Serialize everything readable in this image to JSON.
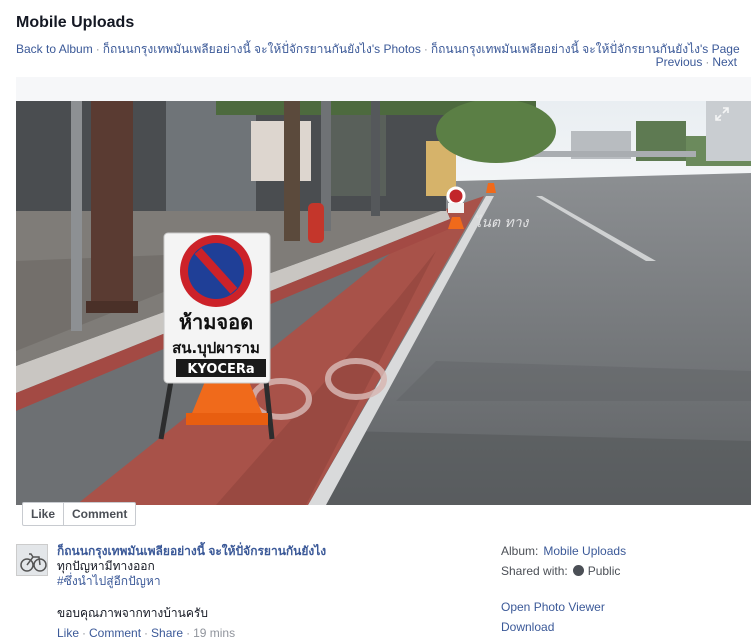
{
  "page": {
    "title": "Mobile Uploads"
  },
  "breadcrumbs": {
    "back": "Back to Album",
    "sep1": "·",
    "photos": "ก็ถนนกรุงเทพมันเพลียอย่างนี้ จะให้ปั่จักรยานกันยังไง's Photos",
    "sep2": "·",
    "page": "ก็ถนนกรุงเทพมันเพลียอย่างนี้ จะให้ปั่จักรยานกันยังไง's Page"
  },
  "pager": {
    "previous": "Previous",
    "sep": "·",
    "next": "Next"
  },
  "photo": {
    "sign_line1": "ห้ามจอด",
    "sign_line2": "สน.บุปผาราม",
    "sign_brand": "KYOCERa",
    "road_text": "ไนต ทาง"
  },
  "photo_actions": {
    "like": "Like",
    "comment": "Comment"
  },
  "post": {
    "author": "ก็ถนนกรุงเทพมันเพลียอย่างนี้ จะให้ปั่จักรยานกันยังไง",
    "line1": "ทุกปัญหามีทางออก",
    "hashtag": "#ซึ่งนำไปสู่อีกปัญหา",
    "message": "ขอบคุณภาพจากทางบ้านครับ",
    "actions": {
      "like": "Like",
      "comment": "Comment",
      "share": "Share",
      "time": "19 mins",
      "sep": "·"
    }
  },
  "sidebar": {
    "album_label": "Album:",
    "album_value": "Mobile Uploads",
    "shared_label": "Shared with:",
    "shared_value": "Public",
    "open_viewer": "Open Photo Viewer",
    "download": "Download"
  },
  "colors": {
    "link": "#3b5998",
    "bike_lane": "#b0574f",
    "sign_red": "#cc2229",
    "sign_blue": "#1f3f97",
    "cone": "#f06a1b"
  },
  "icons": {
    "expand": "expand-icon",
    "globe": "globe-icon"
  }
}
